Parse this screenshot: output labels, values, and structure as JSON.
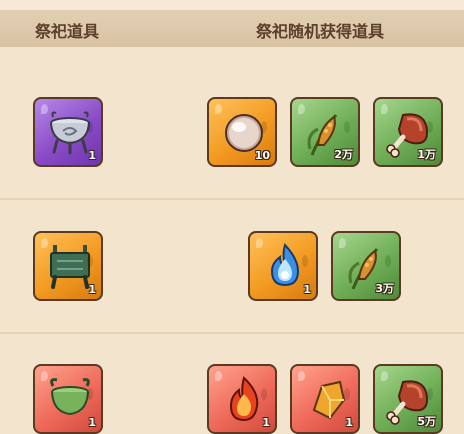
{
  "header": {
    "left_title": "祭祀道具",
    "right_title": "祭祀随机获得道具"
  },
  "colors": {
    "background": "#f3e4cd",
    "header": "#dcc8aa",
    "header_text": "#5c3f2b",
    "purple_frame": "#8a4cc6",
    "orange_frame": "#f39a22",
    "green_frame": "#6fae56",
    "red_frame": "#ef6a5a"
  },
  "rows": [
    {
      "sacrifice": {
        "icon": "silver-censer-icon",
        "frame": "purple",
        "qty": "1"
      },
      "rewards": [
        {
          "icon": "pearl-icon",
          "frame": "orange",
          "qty": "10"
        },
        {
          "icon": "millet-icon",
          "frame": "green",
          "qty": "2万"
        },
        {
          "icon": "meat-leg-icon",
          "frame": "green",
          "qty": "1万"
        }
      ]
    },
    {
      "sacrifice": {
        "icon": "bronze-ding-icon",
        "frame": "orange",
        "qty": "1"
      },
      "rewards": [
        {
          "icon": "blue-spirit-flame-icon",
          "frame": "orange",
          "qty": "1"
        },
        {
          "icon": "millet-icon",
          "frame": "green",
          "qty": "3万"
        }
      ]
    },
    {
      "sacrifice": {
        "icon": "jade-cauldron-icon",
        "frame": "red",
        "qty": "1"
      },
      "rewards": [
        {
          "icon": "red-flame-icon",
          "frame": "red",
          "qty": "1"
        },
        {
          "icon": "golden-ore-icon",
          "frame": "red",
          "qty": "1"
        },
        {
          "icon": "meat-leg-icon",
          "frame": "green",
          "qty": "5万"
        }
      ]
    }
  ]
}
